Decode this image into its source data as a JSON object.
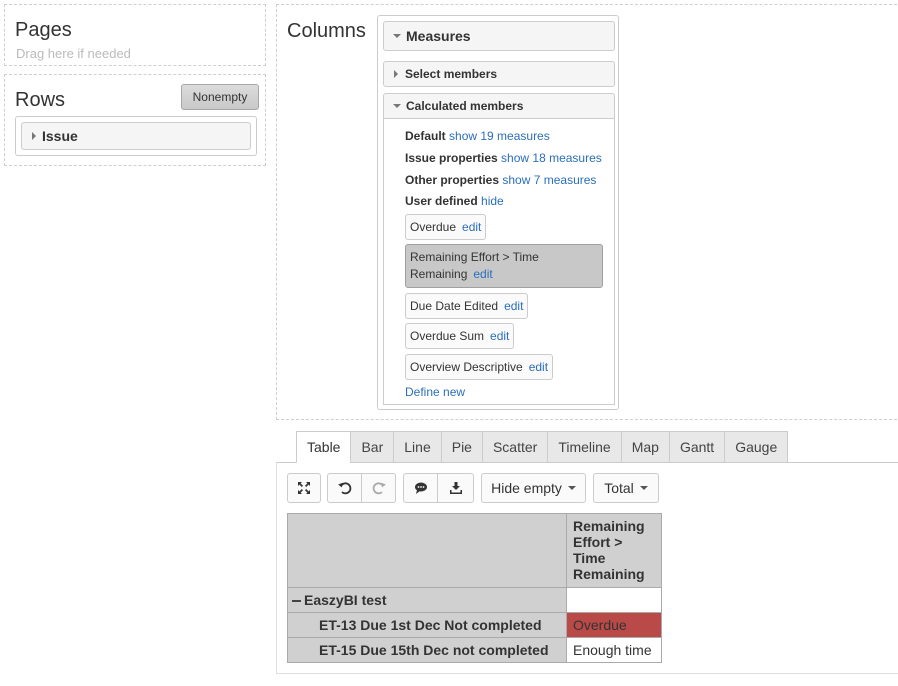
{
  "pages": {
    "title": "Pages",
    "hint": "Drag here if needed"
  },
  "rows": {
    "title": "Rows",
    "nonempty_label": "Nonempty",
    "dimension": "Issue"
  },
  "columns": {
    "title": "Columns",
    "measures_header": "Measures",
    "select_members": "Select members",
    "calculated_members": "Calculated members",
    "groups": [
      {
        "label": "Default",
        "link": "show 19 measures"
      },
      {
        "label": "Issue properties",
        "link": "show 18 measures"
      },
      {
        "label": "Other properties",
        "link": "show 7 measures"
      },
      {
        "label": "User defined",
        "link": "hide"
      }
    ],
    "user_measures": [
      {
        "name": "Overdue",
        "action": "edit"
      },
      {
        "name_line1": "Remaining Effort > Time",
        "name_line2": "Remaining",
        "action": "edit"
      },
      {
        "name": "Due Date Edited",
        "action": "edit"
      },
      {
        "name": "Overdue Sum",
        "action": "edit"
      },
      {
        "name": "Overview Descriptive",
        "action": "edit"
      }
    ],
    "define_new": "Define new"
  },
  "tabs": [
    "Table",
    "Bar",
    "Line",
    "Pie",
    "Scatter",
    "Timeline",
    "Map",
    "Gantt",
    "Gauge"
  ],
  "active_tab": "Table",
  "toolbar": {
    "hide_empty": "Hide empty",
    "total": "Total"
  },
  "table": {
    "column_header": {
      "l1": "Remaining",
      "l2": "Effort >",
      "l3": "Time",
      "l4": "Remaining"
    },
    "group_label": "EaszyBI test",
    "rows": [
      {
        "label": "ET-13 Due 1st Dec Not completed",
        "value": "Overdue",
        "status_color": "#b94a48"
      },
      {
        "label": "ET-15 Due 15th Dec not completed",
        "value": "Enough time"
      }
    ]
  },
  "icons": [
    "expand-icon",
    "undo-icon",
    "redo-icon",
    "comment-icon",
    "download-icon"
  ]
}
